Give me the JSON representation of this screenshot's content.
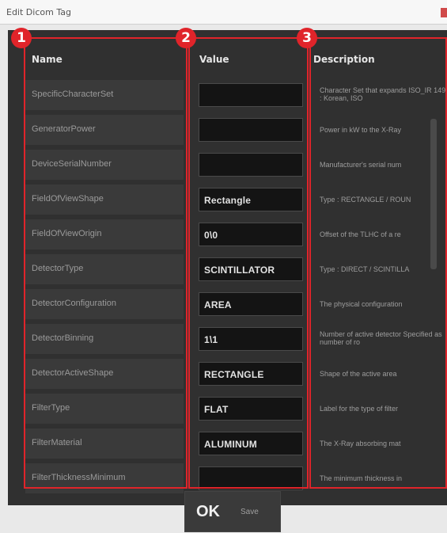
{
  "window": {
    "title": "Edit Dicom Tag"
  },
  "columns": {
    "name": "Name",
    "value": "Value",
    "description": "Description"
  },
  "badges": [
    "1",
    "2",
    "3"
  ],
  "rows": [
    {
      "name": "SpecificCharacterSet",
      "value": "",
      "desc": "Character Set that expands ISO_IR 149 : Korean, ISO"
    },
    {
      "name": "GeneratorPower",
      "value": "",
      "desc": "Power in kW to the X-Ray"
    },
    {
      "name": "DeviceSerialNumber",
      "value": "",
      "desc": "Manufacturer's serial num"
    },
    {
      "name": "FieldOfViewShape",
      "value": "Rectangle",
      "desc": "Type : RECTANGLE / ROUN"
    },
    {
      "name": "FieldOfViewOrigin",
      "value": "0\\0",
      "desc": "Offset of the TLHC of a re"
    },
    {
      "name": "DetectorType",
      "value": "SCINTILLATOR",
      "desc": "Type : DIRECT / SCINTILLA"
    },
    {
      "name": "DetectorConfiguration",
      "value": "AREA",
      "desc": "The physical configuration"
    },
    {
      "name": "DetectorBinning",
      "value": "1\\1",
      "desc": "Number of active detector Specified as number of ro"
    },
    {
      "name": "DetectorActiveShape",
      "value": "RECTANGLE",
      "desc": "Shape of the active area"
    },
    {
      "name": "FilterType",
      "value": "FLAT",
      "desc": "Label for the type of filter"
    },
    {
      "name": "FilterMaterial",
      "value": "ALUMINUM",
      "desc": "The X-Ray absorbing mat"
    },
    {
      "name": "FilterThicknessMinimum",
      "value": "",
      "desc": "The minimum thickness in"
    }
  ],
  "footer": {
    "ok_label": "OK",
    "save_label": "Save"
  },
  "colors": {
    "annotation": "#e0242a",
    "panel": "#303030"
  }
}
